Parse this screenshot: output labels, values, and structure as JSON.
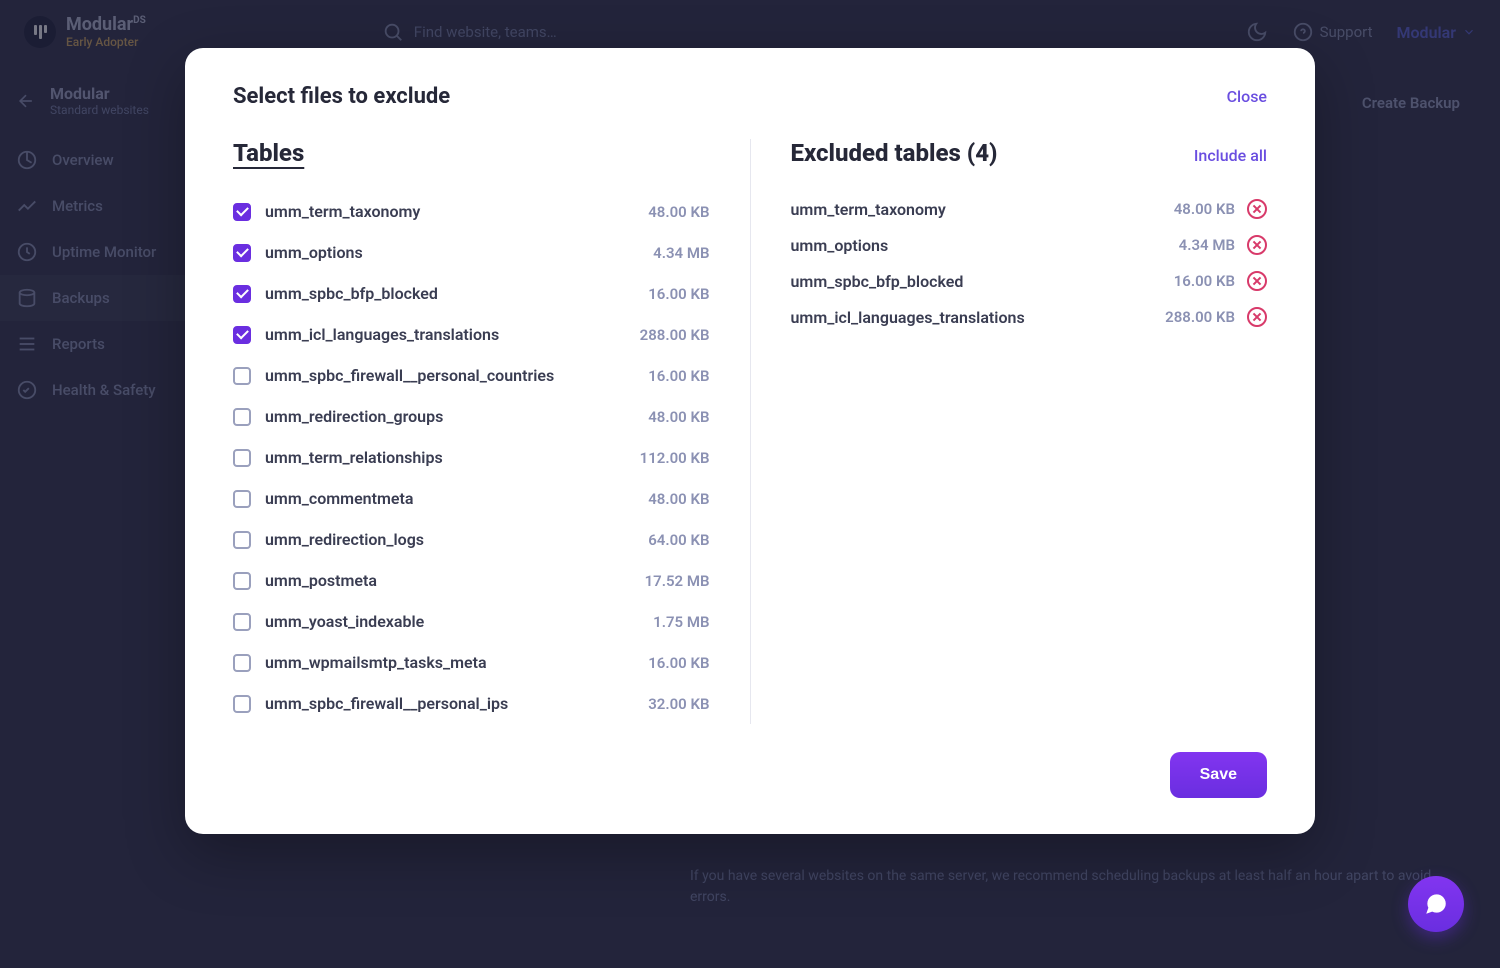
{
  "header": {
    "brand": "Modular",
    "brand_suffix": "DS",
    "tagline": "Early Adopter",
    "search_placeholder": "Find website, teams…",
    "support_label": "Support",
    "user_label": "Modular"
  },
  "sidebar": {
    "site_name": "Modular",
    "site_sub": "Standard websites",
    "items": [
      {
        "label": "Overview"
      },
      {
        "label": "Metrics"
      },
      {
        "label": "Uptime Monitor"
      },
      {
        "label": "Backups"
      },
      {
        "label": "Reports"
      },
      {
        "label": "Health & Safety"
      }
    ]
  },
  "page": {
    "create_backup_label": "Create Backup",
    "bg_note": "If you have several websites on the same server, we recommend scheduling backups at least half an hour apart to avoid errors."
  },
  "modal": {
    "title": "Select files to exclude",
    "close_label": "Close",
    "tables_heading": "Tables",
    "excluded_heading": "Excluded tables (4)",
    "include_all_label": "Include all",
    "save_label": "Save",
    "tables": [
      {
        "name": "umm_term_taxonomy",
        "size": "48.00 KB",
        "checked": true
      },
      {
        "name": "umm_options",
        "size": "4.34 MB",
        "checked": true
      },
      {
        "name": "umm_spbc_bfp_blocked",
        "size": "16.00 KB",
        "checked": true
      },
      {
        "name": "umm_icl_languages_translations",
        "size": "288.00 KB",
        "checked": true
      },
      {
        "name": "umm_spbc_firewall__personal_countries",
        "size": "16.00 KB",
        "checked": false
      },
      {
        "name": "umm_redirection_groups",
        "size": "48.00 KB",
        "checked": false
      },
      {
        "name": "umm_term_relationships",
        "size": "112.00 KB",
        "checked": false
      },
      {
        "name": "umm_commentmeta",
        "size": "48.00 KB",
        "checked": false
      },
      {
        "name": "umm_redirection_logs",
        "size": "64.00 KB",
        "checked": false
      },
      {
        "name": "umm_postmeta",
        "size": "17.52 MB",
        "checked": false
      },
      {
        "name": "umm_yoast_indexable",
        "size": "1.75 MB",
        "checked": false
      },
      {
        "name": "umm_wpmailsmtp_tasks_meta",
        "size": "16.00 KB",
        "checked": false
      },
      {
        "name": "umm_spbc_firewall__personal_ips",
        "size": "32.00 KB",
        "checked": false
      }
    ],
    "excluded": [
      {
        "name": "umm_term_taxonomy",
        "size": "48.00 KB"
      },
      {
        "name": "umm_options",
        "size": "4.34 MB"
      },
      {
        "name": "umm_spbc_bfp_blocked",
        "size": "16.00 KB"
      },
      {
        "name": "umm_icl_languages_translations",
        "size": "288.00 KB"
      }
    ]
  }
}
